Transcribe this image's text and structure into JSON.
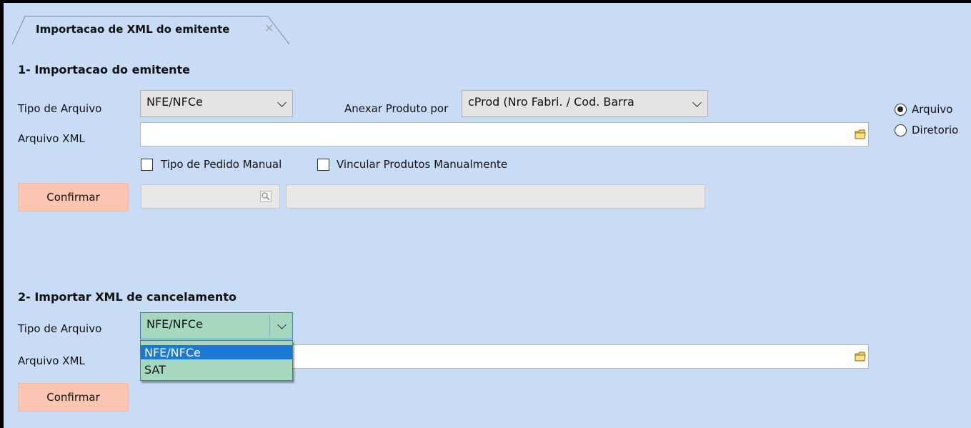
{
  "tab": {
    "title": "Importacao de XML do emitente",
    "close": "✕"
  },
  "section1": {
    "title": "1- Importacao do emitente",
    "tipo_label": "Tipo de Arquivo",
    "tipo_value": "NFE/NFCe",
    "anexar_label": "Anexar Produto por",
    "anexar_value": "cProd (Nro Fabri. / Cod. Barra",
    "arquivo_label": "Arquivo XML",
    "arquivo_value": "",
    "check_pedido": "Tipo de Pedido Manual",
    "check_vincular": "Vincular Produtos Manualmente",
    "confirm": "Confirmar",
    "radio_arquivo": "Arquivo",
    "radio_diretorio": "Diretorio",
    "radio_selected": "Arquivo"
  },
  "section2": {
    "title": "2- Importar XML de cancelamento",
    "tipo_label": "Tipo de Arquivo",
    "tipo_value": "NFE/NFCe",
    "arquivo_label": "Arquivo XML",
    "confirm": "Confirmar",
    "dropdown_options": [
      "NFE/NFCe",
      "SAT"
    ],
    "dropdown_selected": "NFE/NFCe"
  },
  "colors": {
    "background": "#c8dcf6",
    "confirm_button": "#fbc5b2",
    "dropdown_bg": "#a6d8c0",
    "dropdown_highlight": "#1a78d8"
  },
  "icons": {
    "folder": "folder-icon",
    "search": "search-icon",
    "chevron": "chevron-down-icon"
  }
}
